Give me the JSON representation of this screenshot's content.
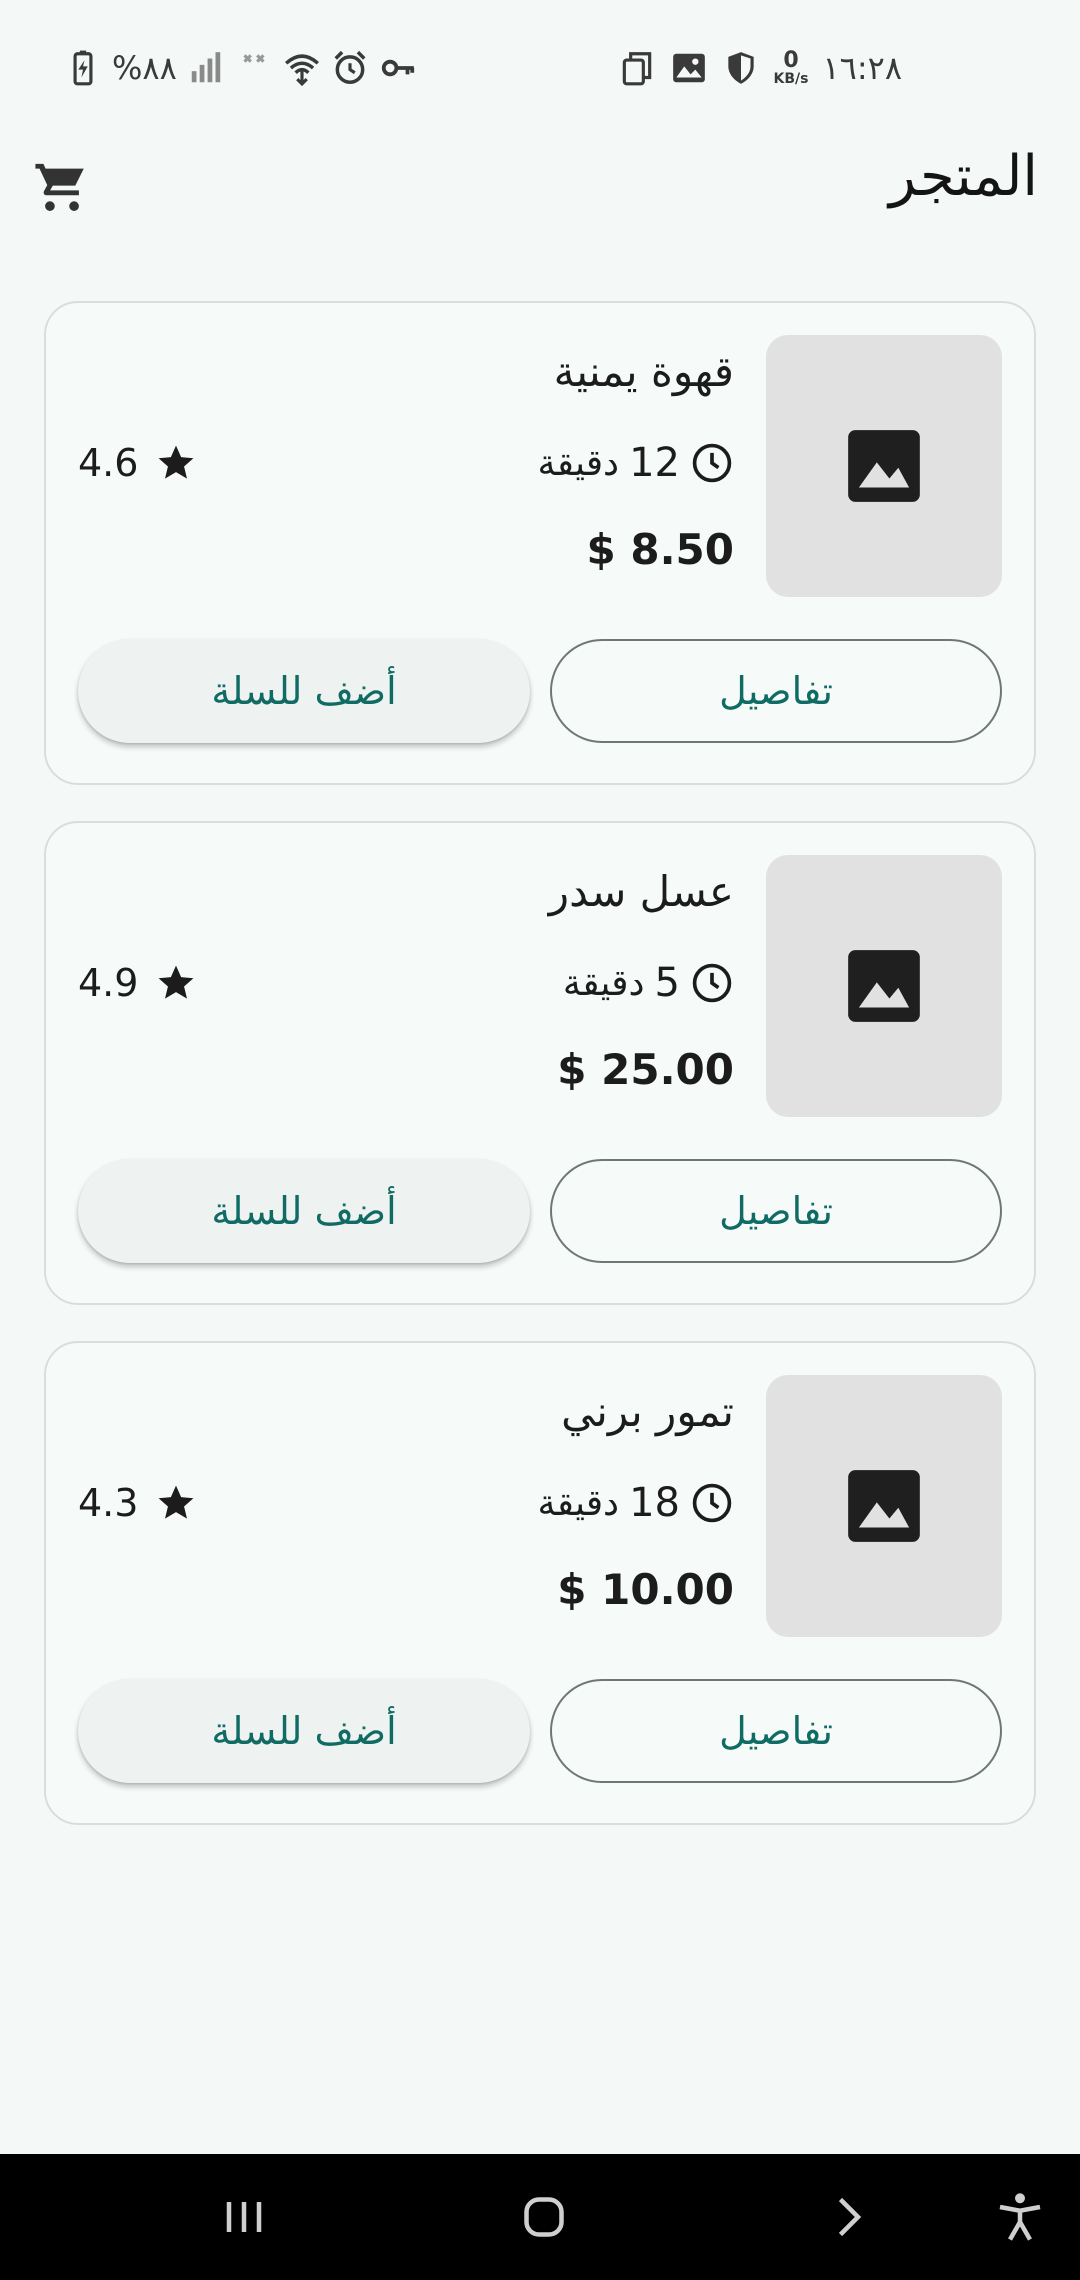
{
  "status_bar": {
    "time": "١٦:٢٨",
    "battery": "%٨٨",
    "net_speed_value": "0",
    "net_speed_unit": "KB/s",
    "left_icons": [
      "battery-charging-icon",
      "signal-bars-icon",
      "data-off-icon",
      "wifi-icon",
      "alarm-icon",
      "vpn-key-icon"
    ],
    "right_icons": [
      "copy-icon",
      "image-icon",
      "shield-icon"
    ]
  },
  "app_bar": {
    "title": "المتجر",
    "cart_icon": "shopping-cart-icon"
  },
  "products": [
    {
      "name": "قهوة يمنية",
      "time_value": "12",
      "time_unit": "دقيقة",
      "price": "$ 8.50",
      "rating": "4.6",
      "details_label": "تفاصيل",
      "add_label": "أضف للسلة"
    },
    {
      "name": "عسل سدر",
      "time_value": "5",
      "time_unit": "دقيقة",
      "price": "$ 25.00",
      "rating": "4.9",
      "details_label": "تفاصيل",
      "add_label": "أضف للسلة"
    },
    {
      "name": "تمور برني",
      "time_value": "18",
      "time_unit": "دقيقة",
      "price": "$ 10.00",
      "rating": "4.3",
      "details_label": "تفاصيل",
      "add_label": "أضف للسلة"
    }
  ],
  "nav_bar": {
    "buttons": [
      "recents-icon",
      "home-icon",
      "back-icon",
      "accessibility-icon"
    ]
  },
  "colors": {
    "background": "#f4f9f8",
    "accent": "#0f6b63",
    "thumb_bg": "#e1e1e1",
    "outline": "#6f7776"
  }
}
